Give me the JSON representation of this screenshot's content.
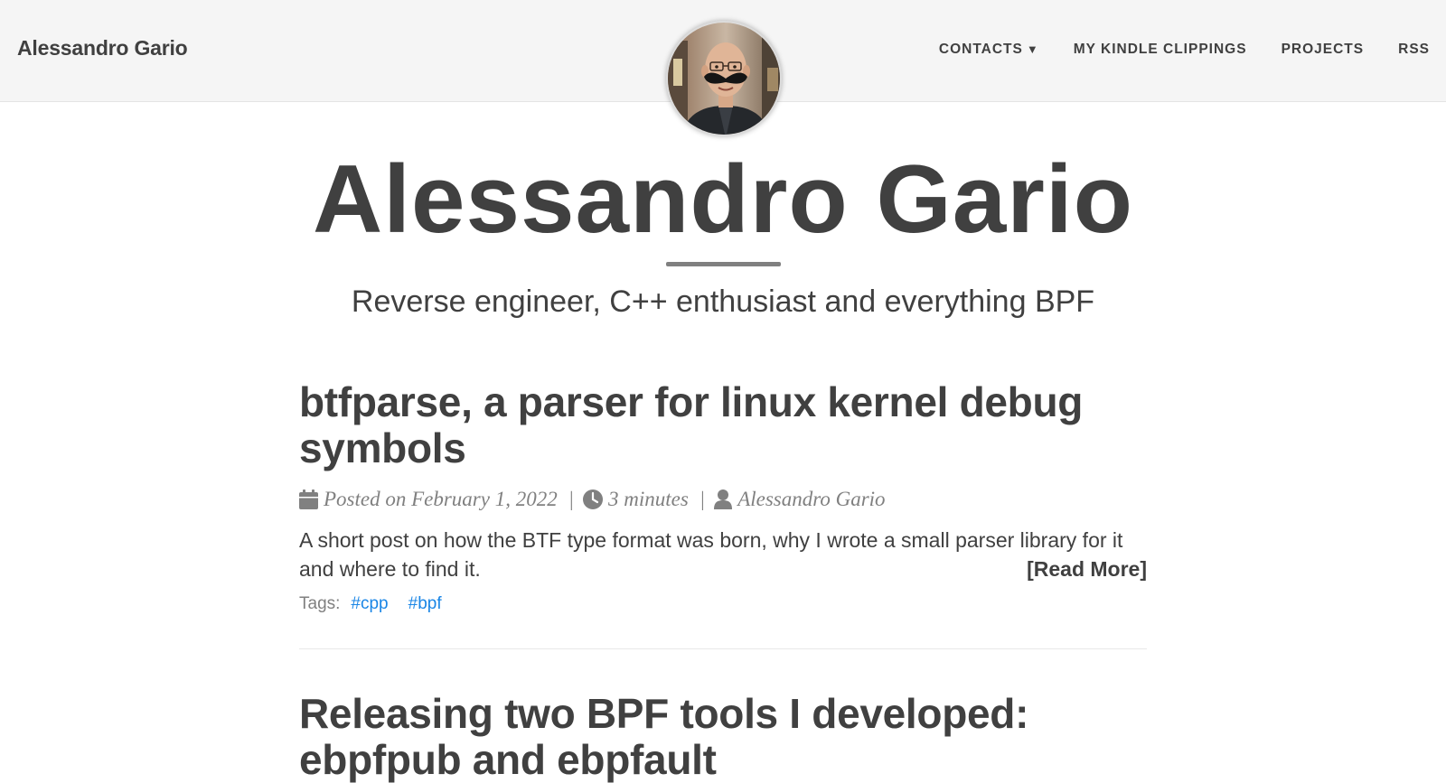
{
  "navbar": {
    "brand": "Alessandro Gario",
    "links": [
      {
        "label": "CONTACTS",
        "caret": "▼"
      },
      {
        "label": "MY KINDLE CLIPPINGS"
      },
      {
        "label": "PROJECTS"
      },
      {
        "label": "RSS"
      }
    ]
  },
  "header": {
    "title": "Alessandro Gario",
    "subtitle": "Reverse engineer, C++ enthusiast and everything BPF"
  },
  "posts": [
    {
      "title": "btfparse, a parser for linux kernel debug symbols",
      "posted_on": "Posted on February 1, 2022",
      "reading_time": "3 minutes",
      "author": "Alessandro Gario",
      "excerpt": "A short post on how the BTF type format was born, why I wrote a small parser library for it and where to find it.",
      "read_more": "[Read More]",
      "tags_label": "Tags:",
      "tags": [
        "#cpp",
        "#bpf"
      ]
    },
    {
      "title": "Releasing two BPF tools I developed: ebpfpub and ebpfault"
    }
  ],
  "colors": {
    "text": "#404040",
    "muted": "#808080",
    "navbar_bg": "#f5f5f5",
    "tag_link": "#1a86e6"
  },
  "icons": {
    "calendar": "calendar-icon",
    "clock": "clock-icon",
    "user": "user-icon"
  }
}
